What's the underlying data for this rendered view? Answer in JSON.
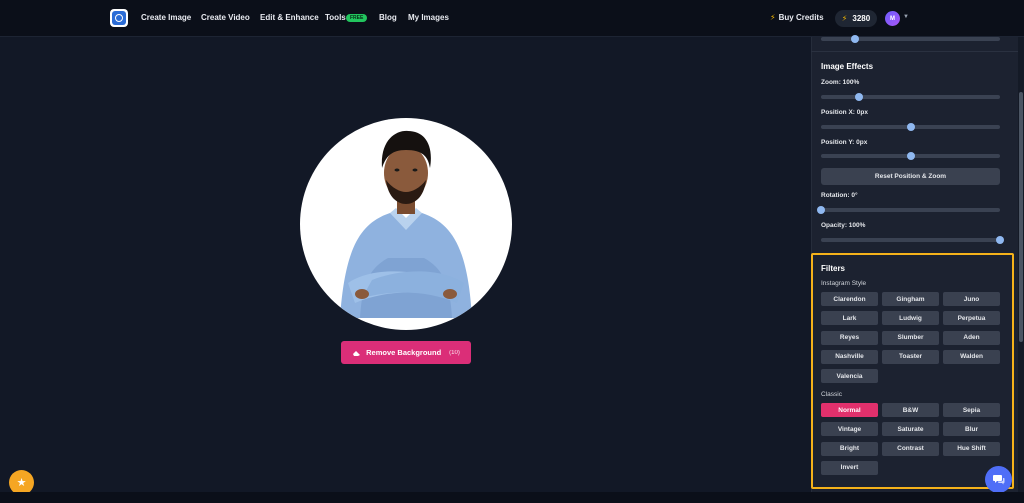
{
  "nav": {
    "items": [
      {
        "label": "Create Image"
      },
      {
        "label": "Create Video"
      },
      {
        "label": "Edit & Enhance"
      },
      {
        "label": "Tools"
      },
      {
        "label": "Blog"
      },
      {
        "label": "My Images"
      }
    ],
    "tools_badge": "FREE",
    "buy_credits": "Buy Credits",
    "credits": "3280",
    "avatar_initial": "M"
  },
  "editor": {
    "remove_bg_label": "Remove Background",
    "remove_bg_count": "(10)"
  },
  "panel": {
    "effects_title": "Image Effects",
    "zoom_label": "Zoom: 100%",
    "posx_label": "Position X: 0px",
    "posy_label": "Position Y: 0px",
    "reset_label": "Reset Position & Zoom",
    "rotation_label": "Rotation: 0°",
    "opacity_label": "Opacity: 100%",
    "sliders": {
      "top_partial": 0.19,
      "zoom": 0.21,
      "posx": 0.5,
      "posy": 0.5,
      "rotation": 0.0,
      "opacity": 1.0
    },
    "filters_title": "Filters",
    "instagram_label": "Instagram Style",
    "instagram": [
      "Clarendon",
      "Gingham",
      "Juno",
      "Lark",
      "Ludwig",
      "Perpetua",
      "Reyes",
      "Slumber",
      "Aden",
      "Nashville",
      "Toaster",
      "Walden",
      "Valencia"
    ],
    "classic_label": "Classic",
    "classic": [
      "Normal",
      "B&W",
      "Sepia",
      "Vintage",
      "Saturate",
      "Blur",
      "Bright",
      "Contrast",
      "Hue Shift",
      "Invert"
    ],
    "classic_selected": "Normal"
  },
  "colors": {
    "accent_pink": "#db2e78",
    "highlight": "#f5b21a",
    "background": "#121826",
    "panel": "#1c2230"
  }
}
